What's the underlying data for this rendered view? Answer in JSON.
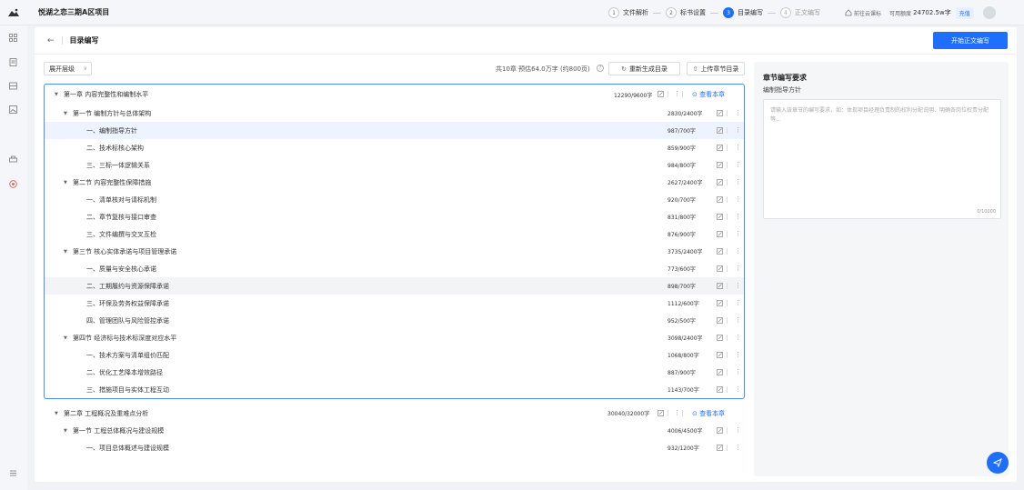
{
  "header": {
    "project_title": "悦湖之恋三期A区项目",
    "steps": [
      {
        "num": "1",
        "label": "文件解析",
        "state": "done"
      },
      {
        "num": "2",
        "label": "标书设置",
        "state": "done"
      },
      {
        "num": "3",
        "label": "目录编写",
        "state": "active"
      },
      {
        "num": "4",
        "label": "正文编写",
        "state": "disabled"
      }
    ],
    "cloud_link": "前往云课标",
    "quota_label": "可用额度",
    "quota_value": "24702.5w字",
    "recharge": "充值"
  },
  "page": {
    "back": "←",
    "title": "目录编写",
    "start_button": "开始正文编写"
  },
  "toolbar": {
    "expand_level": "展开层级",
    "summary": "共10章 预估64.0万字 (约800页)",
    "help": "?",
    "regenerate": "重新生成目录",
    "upload": "上传章节目录"
  },
  "chapter1": {
    "title": "第一章 内容完整性和编制水平",
    "count": "12290/9600字",
    "view": "查看本章",
    "sections": [
      {
        "title": "第一节 编制方针与总体架构",
        "count": "2830/2400字",
        "items": [
          {
            "title": "一、编制指导方针",
            "count": "987/700字"
          },
          {
            "title": "二、技术标核心架构",
            "count": "859/900字"
          },
          {
            "title": "三、三标一体逻辑关系",
            "count": "984/800字"
          }
        ]
      },
      {
        "title": "第二节 内容完整性保障措施",
        "count": "2627/2400字",
        "items": [
          {
            "title": "一、清单核对与请标机制",
            "count": "920/700字"
          },
          {
            "title": "二、章节复核与接口审查",
            "count": "831/800字"
          },
          {
            "title": "三、文件编撰与交叉互检",
            "count": "876/900字"
          }
        ]
      },
      {
        "title": "第三节 核心实体承诺与项目管理承诺",
        "count": "3735/2400字",
        "items": [
          {
            "title": "一、质量与安全核心承诺",
            "count": "773/600字"
          },
          {
            "title": "二、工期履约与资源保障承诺",
            "count": "898/700字"
          },
          {
            "title": "三、环保及劳务权益保障承诺",
            "count": "1112/600字"
          },
          {
            "title": "四、管理团队与风险管控承诺",
            "count": "952/500字"
          }
        ]
      },
      {
        "title": "第四节 经济标与技术标深度对应水平",
        "count": "3098/2400字",
        "items": [
          {
            "title": "一、技术方案与清单组价匹配",
            "count": "1068/800字"
          },
          {
            "title": "二、优化工艺降本增效路径",
            "count": "887/900字"
          },
          {
            "title": "三、措施项目与实体工程互动",
            "count": "1143/700字"
          }
        ]
      }
    ]
  },
  "chapter2": {
    "title": "第二章 工程概况及重难点分析",
    "count": "30040/32000字",
    "view": "查看本章",
    "section_title": "第一节 工程总体概况与建设规模",
    "section_count": "4006/4500字",
    "item_title": "一、项目总体概述与建设规模",
    "item_count": "932/1200字"
  },
  "side": {
    "title": "章节编写要求",
    "subtitle": "编制指导方针",
    "placeholder": "请输入该章节的编写要求，如：体现项目经理负责制的权利分配说明、明确各岗位权责分配等...",
    "counter": "0/10000"
  },
  "colors": {
    "accent": "#1e6fff",
    "highlight": "#edf3ff",
    "border_focus": "#4a8bff"
  }
}
